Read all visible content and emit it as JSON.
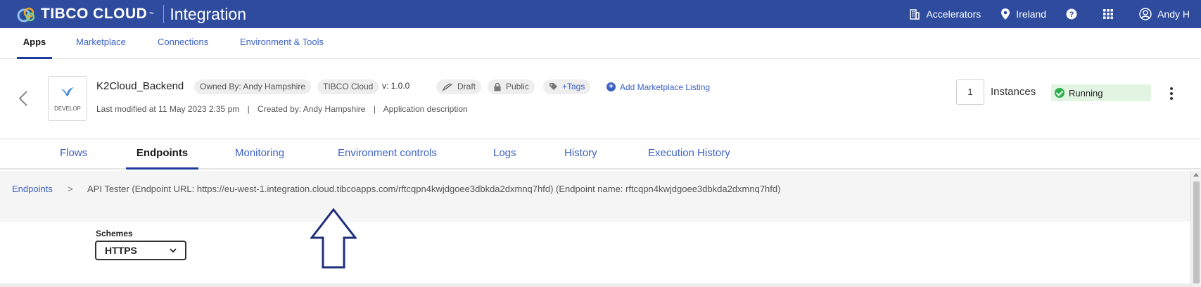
{
  "topbar": {
    "brand": "TIBCO CLOUD",
    "trademark": "™",
    "product": "Integration",
    "accelerators": "Accelerators",
    "region": "Ireland",
    "user": "Andy H"
  },
  "nav": {
    "tabs": [
      "Apps",
      "Marketplace",
      "Connections",
      "Environment & Tools"
    ]
  },
  "app": {
    "name": "K2Cloud_Backend",
    "badge": "DEVELOP",
    "owned_by": "Owned By:  Andy Hampshire",
    "platform": "TIBCO Cloud",
    "version": "v: 1.0.0",
    "draft": "Draft",
    "visibility": "Public",
    "tags": "+Tags",
    "add_listing": "Add Marketplace Listing",
    "last_modified": "Last modified at 11 May 2023 2:35 pm",
    "created_by": "Created by: Andy Hampshire",
    "description": "Application description",
    "instances": "1",
    "instances_label": "Instances",
    "status": "Running"
  },
  "subtabs": [
    "Flows",
    "Endpoints",
    "Monitoring",
    "Environment controls",
    "Logs",
    "History",
    "Execution History"
  ],
  "breadcrumb": {
    "link": "Endpoints",
    "current": "API Tester (Endpoint URL: https://eu-west-1.integration.cloud.tibcoapps.com/rftcqpn4kwjdgoee3dbkda2dxmnq7hfd)  (Endpoint name: rftcqpn4kwjdgoee3dbkda2dxmnq7hfd)"
  },
  "schemes": {
    "label": "Schemes",
    "selected": "HTTPS"
  },
  "colors": {
    "topbar": "#2e4b9e",
    "link": "#3d62c4",
    "running_bg": "#e2f4e2",
    "arrow": "#1f2f7a"
  }
}
